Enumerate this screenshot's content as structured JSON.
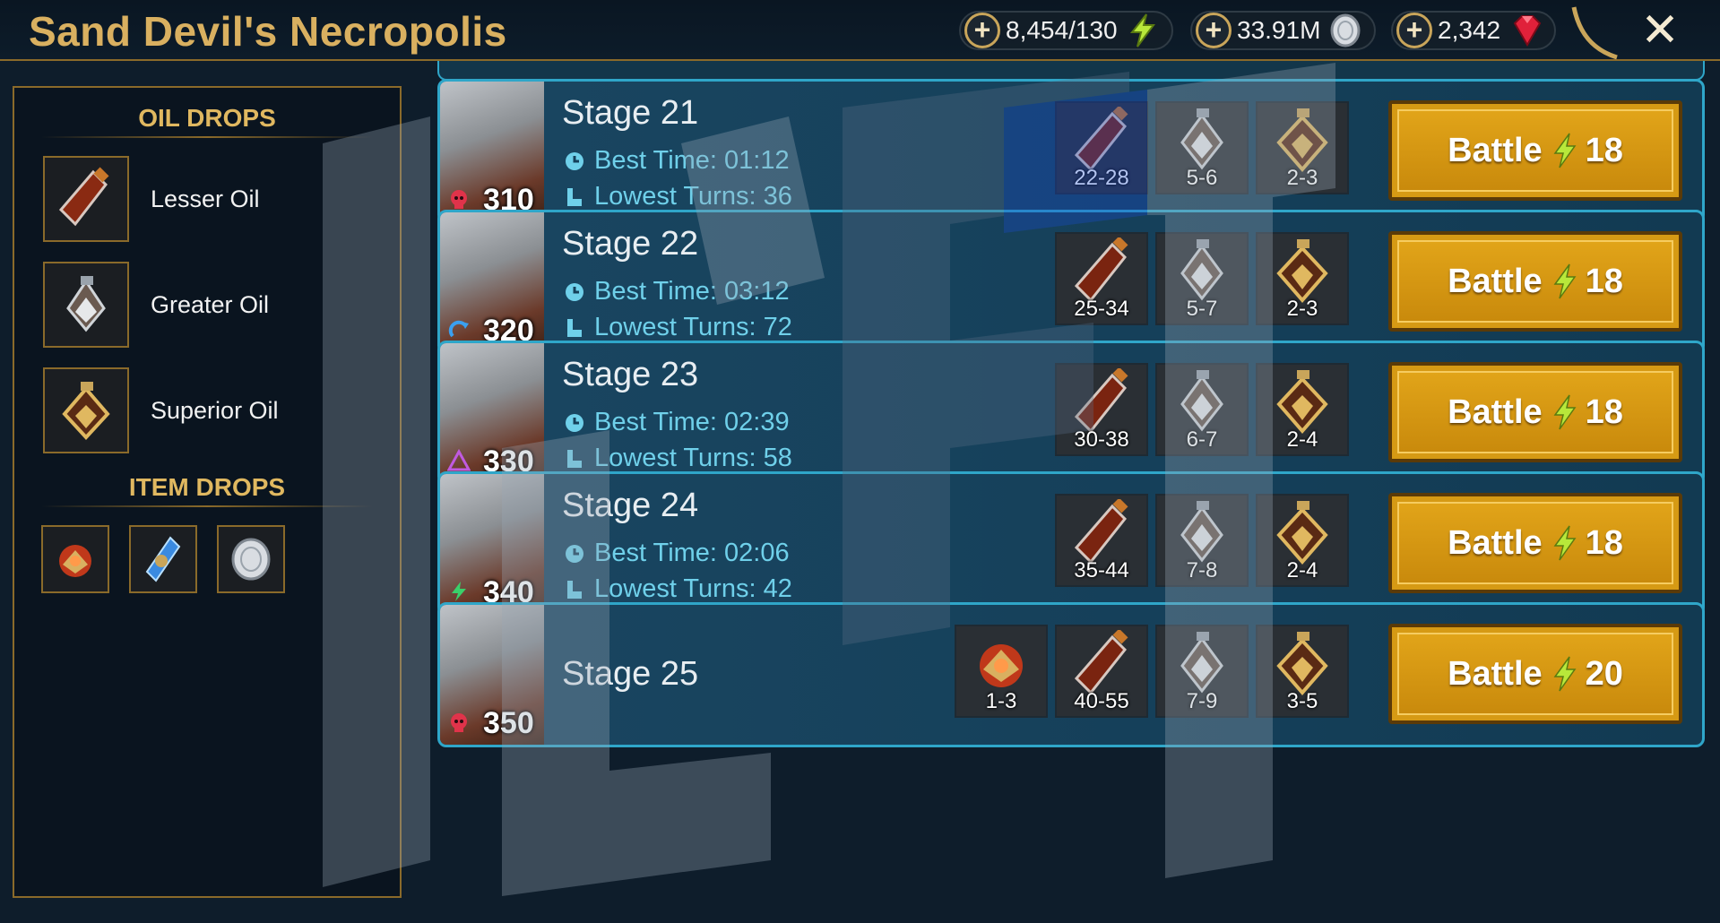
{
  "header": {
    "title": "Sand Devil's Necropolis",
    "energy": "8,454/130",
    "silver": "33.91M",
    "gems": "2,342",
    "close_icon": "close-icon"
  },
  "left_panel": {
    "oil_heading": "OIL DROPS",
    "oils": [
      {
        "label": "Lesser Oil",
        "icon": "lesser-oil-icon"
      },
      {
        "label": "Greater Oil",
        "icon": "greater-oil-icon"
      },
      {
        "label": "Superior Oil",
        "icon": "superior-oil-icon"
      }
    ],
    "item_heading": "ITEM DROPS",
    "items": [
      "potion-icon",
      "artifact-icon",
      "silver-coin-icon"
    ]
  },
  "stages": [
    {
      "name": "Stage 21",
      "power": "310",
      "affinity": "force",
      "best_time": "Best Time: 01:12",
      "lowest_turns": "Lowest Turns: 36",
      "drops": [
        "22-28",
        "5-6",
        "2-3"
      ],
      "battle_label": "Battle",
      "energy_cost": "18"
    },
    {
      "name": "Stage 22",
      "power": "320",
      "affinity": "magic",
      "best_time": "Best Time: 03:12",
      "lowest_turns": "Lowest Turns: 72",
      "drops": [
        "25-34",
        "5-7",
        "2-3"
      ],
      "battle_label": "Battle",
      "energy_cost": "18"
    },
    {
      "name": "Stage 23",
      "power": "330",
      "affinity": "void",
      "best_time": "Best Time: 02:39",
      "lowest_turns": "Lowest Turns: 58",
      "drops": [
        "30-38",
        "6-7",
        "2-4"
      ],
      "battle_label": "Battle",
      "energy_cost": "18"
    },
    {
      "name": "Stage 24",
      "power": "340",
      "affinity": "spirit",
      "best_time": "Best Time: 02:06",
      "lowest_turns": "Lowest Turns: 42",
      "drops": [
        "35-44",
        "7-8",
        "2-4"
      ],
      "battle_label": "Battle",
      "energy_cost": "18"
    },
    {
      "name": "Stage 25",
      "power": "350",
      "affinity": "force",
      "item_drop": "1-3",
      "drops": [
        "40-55",
        "7-9",
        "3-5"
      ],
      "battle_label": "Battle",
      "energy_cost": "20"
    }
  ],
  "colors": {
    "title_gold": "#d9b060",
    "stat_cyan": "#6fd0ea",
    "battle_gold": "#d69a14",
    "frame_blue": "#2fa6c9"
  }
}
